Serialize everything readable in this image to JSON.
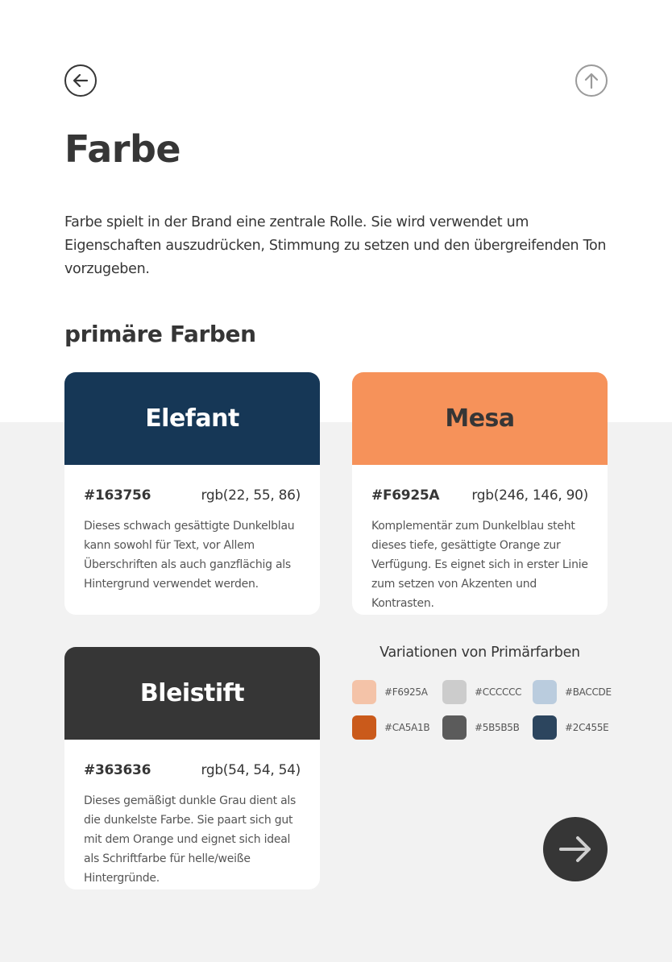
{
  "header": {
    "back_icon": "arrow-left-circle-icon",
    "up_icon": "arrow-up-circle-icon",
    "title": "Farbe",
    "intro": "Farbe spielt in der Brand eine zentrale Rolle. Sie wird verwendet um Eigenschaften auszudrücken, Stimmung zu setzen und den übergreifenden Ton vorzugeben."
  },
  "section": {
    "title": "primäre Farben"
  },
  "cards": [
    {
      "name": "Elefant",
      "hex": "#163756",
      "rgb": "rgb(22, 55, 86)",
      "color": "#163756",
      "text_color": "#ffffff",
      "description": "Dieses schwach gesättigte Dunkelblau kann sowohl für Text, vor Allem Überschriften als auch ganzflächig als Hintergrund verwendet werden."
    },
    {
      "name": "Mesa",
      "hex": "#F6925A",
      "rgb": "rgb(246, 146, 90)",
      "color": "#F6925A",
      "text_color": "#363636",
      "description": "Komplementär zum Dunkelblau steht dieses tiefe, gesättigte Orange zur Verfügung. Es eignet sich in erster Linie zum setzen von Akzenten und Kontrasten."
    },
    {
      "name": "Bleistift",
      "hex": "#363636",
      "rgb": "rgb(54, 54, 54)",
      "color": "#363636",
      "text_color": "#ffffff",
      "description": "Dieses gemäßigt dunkle Grau dient als die dunkelste Farbe. Sie paart sich gut mit dem Orange und eignet sich ideal als Schriftfarbe für helle/weiße Hintergründe."
    }
  ],
  "variations": {
    "title": "Variationen von Primärfarben",
    "swatches": [
      {
        "label": "#F6925A",
        "color": "#F4C3A8"
      },
      {
        "label": "#CCCCCC",
        "color": "#CCCCCC"
      },
      {
        "label": "#BACCDE",
        "color": "#BACCDE"
      },
      {
        "label": "#CA5A1B",
        "color": "#CA5A1B"
      },
      {
        "label": "#5B5B5B",
        "color": "#5B5B5B"
      },
      {
        "label": "#2C455E",
        "color": "#2C455E"
      }
    ]
  },
  "footer": {
    "next_icon": "arrow-right-icon"
  }
}
